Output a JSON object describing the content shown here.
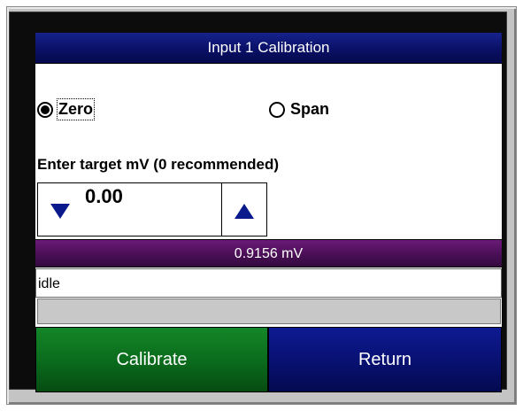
{
  "header": {
    "title": "Input 1 Calibration"
  },
  "mode": {
    "options": [
      {
        "label": "Zero",
        "selected": true
      },
      {
        "label": "Span",
        "selected": false
      }
    ]
  },
  "target": {
    "label": "Enter target mV (0 recommended)",
    "value": "0.00",
    "decrement_icon": "down-triangle-icon",
    "increment_icon": "up-triangle-icon"
  },
  "reading": {
    "text": "0.9156 mV"
  },
  "status": {
    "text": "idle"
  },
  "progress": {
    "fraction": 0
  },
  "buttons": {
    "calibrate_label": "Calibrate",
    "return_label": "Return"
  },
  "colors": {
    "title_bar": "#0a1066",
    "readout_bar": "#4a0f56",
    "calibrate_button": "#0a6a1c",
    "return_button": "#081070",
    "arrow": "#0a1a8c"
  }
}
